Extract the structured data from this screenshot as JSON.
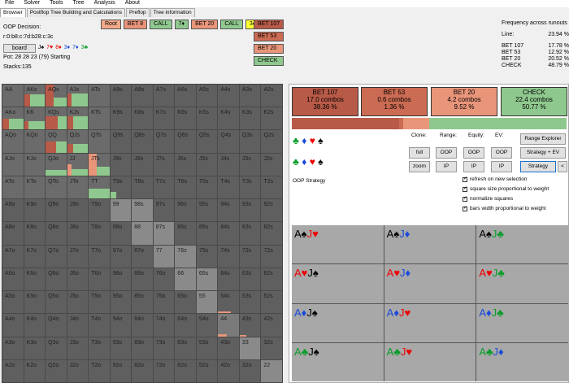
{
  "menu": [
    "File",
    "Solver",
    "Tools",
    "Tree",
    "Analysis",
    "About"
  ],
  "tabs": [
    "Browser",
    "Postflop Tree Building and Calculations",
    "Preflop",
    "Tree information"
  ],
  "decision": {
    "title": "OOP Decision:",
    "board": "r:0:b8:c:7d:b28:c:3c",
    "board_button": "board",
    "pot": "Pot: 28 28 23 (79) Starting Stacks:135",
    "cards": [
      {
        "t": "J♠",
        "c": "b"
      },
      {
        "t": "7♥",
        "c": "r"
      },
      {
        "t": "8♦",
        "c": "r"
      },
      {
        "t": "3♦",
        "c": "bl"
      },
      {
        "t": "7♦",
        "c": "bl"
      },
      {
        "t": "3♣",
        "c": "g"
      }
    ]
  },
  "nav": {
    "items": [
      {
        "label": "Root",
        "color": "#f1a98a"
      },
      {
        "label": "BET 8",
        "color": "#e9957a"
      },
      {
        "label": "CALL",
        "color": "#8fc88e"
      },
      {
        "label": "7♦",
        "color": "#8fc88e"
      },
      {
        "label": "BET 20",
        "color": "#e9957a"
      },
      {
        "label": "CALL",
        "color": "#8fc88e"
      },
      {
        "label": "3♣",
        "color": "#ffff33"
      }
    ],
    "options": [
      {
        "label": "BET 107",
        "color": "#b85a48"
      },
      {
        "label": "BET 53",
        "color": "#cc6b53"
      },
      {
        "label": "BET 20",
        "color": "#e9957a"
      },
      {
        "label": "CHECK",
        "color": "#8fc88e"
      }
    ]
  },
  "frequency": {
    "title": "Frequency across runouts",
    "rows": [
      {
        "k": "Line:",
        "v": "23.94 %"
      },
      {
        "k": "BET 107",
        "v": "17.78 %"
      },
      {
        "k": "BET 53",
        "v": "12.92 %"
      },
      {
        "k": "BET 20",
        "v": "20.52 %"
      },
      {
        "k": "CHECK",
        "v": "48.79 %"
      }
    ]
  },
  "grid": [
    [
      "AA",
      "AKs",
      "AQs",
      "AJs",
      "ATs",
      "A9s",
      "A8s",
      "A7s",
      "A6s",
      "A5s",
      "A4s",
      "A3s",
      "A2s"
    ],
    [
      "AKo",
      "KK",
      "KQs",
      "KJs",
      "KTs",
      "K9s",
      "K8s",
      "K7s",
      "K6s",
      "K5s",
      "K4s",
      "K3s",
      "K2s"
    ],
    [
      "AQo",
      "KQo",
      "QQ",
      "QJs",
      "QTs",
      "Q9s",
      "Q8s",
      "Q7s",
      "Q6s",
      "Q5s",
      "Q4s",
      "Q3s",
      "Q2s"
    ],
    [
      "AJo",
      "KJo",
      "QJo",
      "JJ",
      "JTs",
      "J9s",
      "J8s",
      "J7s",
      "J6s",
      "J5s",
      "J4s",
      "J3s",
      "J2s"
    ],
    [
      "ATo",
      "KTo",
      "QTo",
      "JTo",
      "TT",
      "T9s",
      "T8s",
      "T7s",
      "T6s",
      "T5s",
      "T4s",
      "T3s",
      "T2s"
    ],
    [
      "A9o",
      "K9o",
      "Q9o",
      "J9o",
      "T9o",
      "99",
      "98s",
      "97s",
      "96s",
      "95s",
      "94s",
      "93s",
      "92s"
    ],
    [
      "A8o",
      "K8o",
      "Q8o",
      "J8o",
      "T8o",
      "98o",
      "88",
      "87s",
      "86s",
      "85s",
      "84s",
      "83s",
      "82s"
    ],
    [
      "A7o",
      "K7o",
      "Q7o",
      "J7o",
      "T7o",
      "97o",
      "87o",
      "77",
      "76s",
      "75s",
      "74s",
      "73s",
      "72s"
    ],
    [
      "A6o",
      "K6o",
      "Q6o",
      "J6o",
      "T6o",
      "96o",
      "86o",
      "76o",
      "66",
      "65s",
      "64s",
      "63s",
      "62s"
    ],
    [
      "A5o",
      "K5o",
      "Q5o",
      "J5o",
      "T5o",
      "95o",
      "85o",
      "75o",
      "65o",
      "55",
      "54s",
      "53s",
      "52s"
    ],
    [
      "A4o",
      "K4o",
      "Q4o",
      "J4o",
      "T4o",
      "94o",
      "84o",
      "74o",
      "64o",
      "54o",
      "44",
      "43s",
      "42s"
    ],
    [
      "A3o",
      "K3o",
      "Q3o",
      "J3o",
      "T3o",
      "93o",
      "83o",
      "73o",
      "63o",
      "53o",
      "43o",
      "33",
      "32s"
    ],
    [
      "A2o",
      "K2o",
      "Q2o",
      "J2o",
      "T2o",
      "92o",
      "82o",
      "72o",
      "62o",
      "52o",
      "42o",
      "32o",
      "22"
    ]
  ],
  "actions": [
    {
      "name": "BET 107",
      "combos": "17.0 combos",
      "pct": "38.36 %",
      "color": "#b85a48"
    },
    {
      "name": "BET 53",
      "combos": "0.6 combos",
      "pct": "1.36 %",
      "color": "#cc6b53"
    },
    {
      "name": "BET 20",
      "combos": "4.2 combos",
      "pct": "9.52 %",
      "color": "#e9957a"
    },
    {
      "name": "CHECK",
      "combos": "22.4 combos",
      "pct": "50.77 %",
      "color": "#8fc88e"
    }
  ],
  "controls": {
    "clone": "Clone:",
    "range": "Range:",
    "equity": "Equity:",
    "ev": "EV:",
    "full": "full",
    "zoom": "zoom",
    "oop": "OOP",
    "ip": "IP",
    "range_explorer": "Range Explorer",
    "strategy_ev": "Strategy + EV",
    "strategy": "Strategy",
    "back": "<",
    "oop_strategy": "OOP Strategy",
    "checks": [
      "refresh on new selection",
      "square size proportional to weight",
      "normalize squares",
      "bars width proportional to weight"
    ]
  },
  "combos": [
    [
      {
        "a": "A♠",
        "ac": "b",
        "b": "J♥",
        "bc": "r"
      },
      {
        "a": "A♠",
        "ac": "b",
        "b": "J♦",
        "bc": "bl"
      },
      {
        "a": "A♠",
        "ac": "b",
        "b": "J♣",
        "bc": "g"
      }
    ],
    [
      {
        "a": "A♥",
        "ac": "r",
        "b": "J♠",
        "bc": "b"
      },
      {
        "a": "A♥",
        "ac": "r",
        "b": "J♦",
        "bc": "bl"
      },
      {
        "a": "A♥",
        "ac": "r",
        "b": "J♣",
        "bc": "g"
      }
    ],
    [
      {
        "a": "A♦",
        "ac": "bl",
        "b": "J♠",
        "bc": "b"
      },
      {
        "a": "A♦",
        "ac": "bl",
        "b": "J♥",
        "bc": "r"
      },
      {
        "a": "A♦",
        "ac": "bl",
        "b": "J♣",
        "bc": "g"
      }
    ],
    [
      {
        "a": "A♣",
        "ac": "g",
        "b": "J♠",
        "bc": "b"
      },
      {
        "a": "A♣",
        "ac": "g",
        "b": "J♥",
        "bc": "r"
      },
      {
        "a": "A♣",
        "ac": "g",
        "b": "J♦",
        "bc": "bl"
      }
    ]
  ]
}
